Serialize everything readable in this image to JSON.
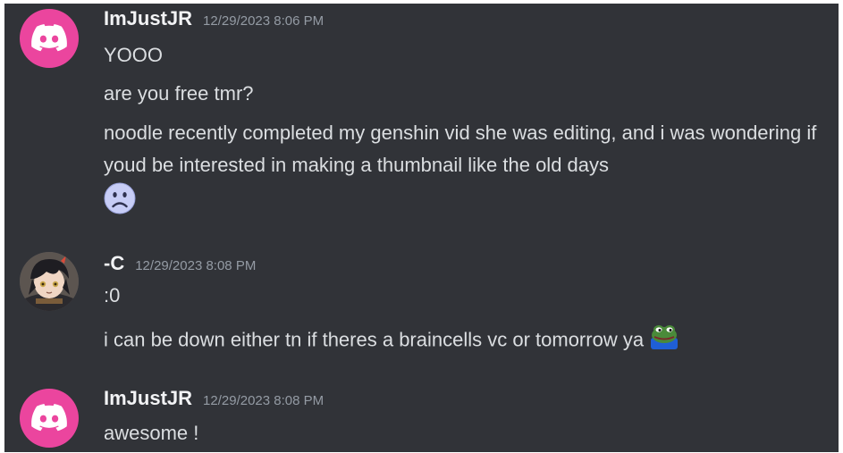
{
  "messages": [
    {
      "username": "ImJustJR",
      "timestamp": "12/29/2023 8:06 PM",
      "avatar_icon": "discord-logo-icon",
      "lines": [
        "YOOO",
        "are you free tmr?",
        "noodle recently completed my genshin vid she was editing, and i was wondering if youd be interested in making a thumbnail like the old days"
      ],
      "reaction_emoji": "frowning-face-emoji"
    },
    {
      "username": "-C",
      "timestamp": "12/29/2023 8:08 PM",
      "avatar_icon": "anime-character-avatar",
      "lines": [
        ":0",
        "i can be down either tn if theres a braincells vc or tomorrow ya"
      ],
      "inline_emoji": "pepe-frog-emoji"
    },
    {
      "username": "ImJustJR",
      "timestamp": "12/29/2023 8:08 PM",
      "avatar_icon": "discord-logo-icon",
      "lines": [
        "awesome !"
      ]
    }
  ],
  "colors": {
    "background": "#313338",
    "username": "#f2f3f5",
    "timestamp": "#949ba4",
    "message_text": "#dbdee1",
    "discord_avatar": "#eb459e"
  }
}
